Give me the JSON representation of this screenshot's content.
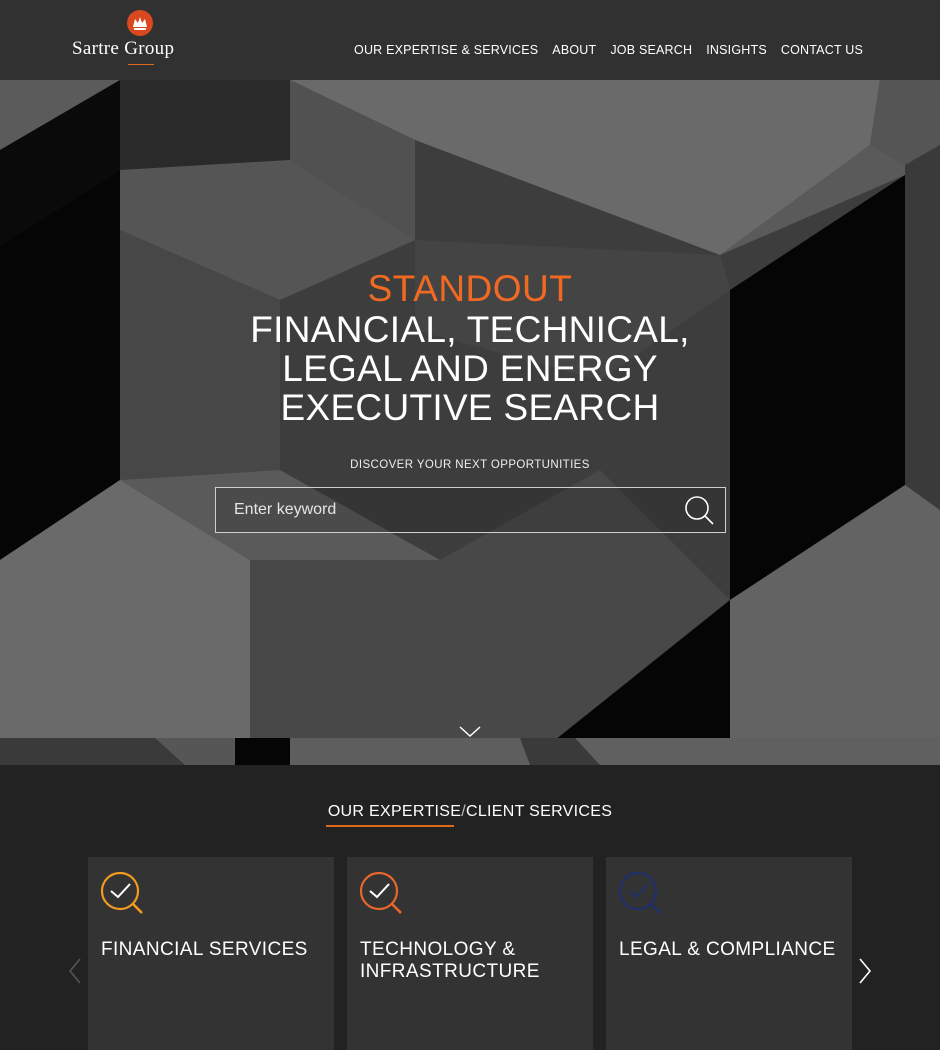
{
  "brand": {
    "name": "Sartre Group",
    "logo_icon": "crown-emblem-icon",
    "accent_color": "#f26a21"
  },
  "nav": {
    "items": [
      {
        "label": "OUR EXPERTISE & SERVICES"
      },
      {
        "label": "ABOUT"
      },
      {
        "label": "JOB SEARCH"
      },
      {
        "label": "INSIGHTS"
      },
      {
        "label": "CONTACT US"
      }
    ]
  },
  "hero": {
    "accent": "STANDOUT",
    "lines": [
      "FINANCIAL, TECHNICAL,",
      "LEGAL AND ENERGY",
      "EXECUTIVE SEARCH"
    ],
    "subtitle": "DISCOVER YOUR NEXT OPPORTUNITIES"
  },
  "search": {
    "placeholder": "Enter keyword",
    "value": "",
    "icon": "search-icon"
  },
  "scroll": {
    "icon": "chevron-down-icon"
  },
  "expertise": {
    "title_left": "OUR EXPERTISE",
    "separator": "/",
    "title_right": "CLIENT SERVICES",
    "cards": [
      {
        "label": "FINANCIAL SERVICES",
        "icon": "magnifier-check-icon",
        "icon_color": "#f39a21"
      },
      {
        "label": "TECHNOLOGY & INFRASTRUCTURE",
        "icon": "magnifier-check-icon",
        "icon_color": "#e8672a"
      },
      {
        "label": "LEGAL & COMPLIANCE",
        "icon": "magnifier-check-icon",
        "icon_color": "#1f2f6b"
      }
    ],
    "prev_icon": "chevron-left-icon",
    "next_icon": "chevron-right-icon"
  }
}
